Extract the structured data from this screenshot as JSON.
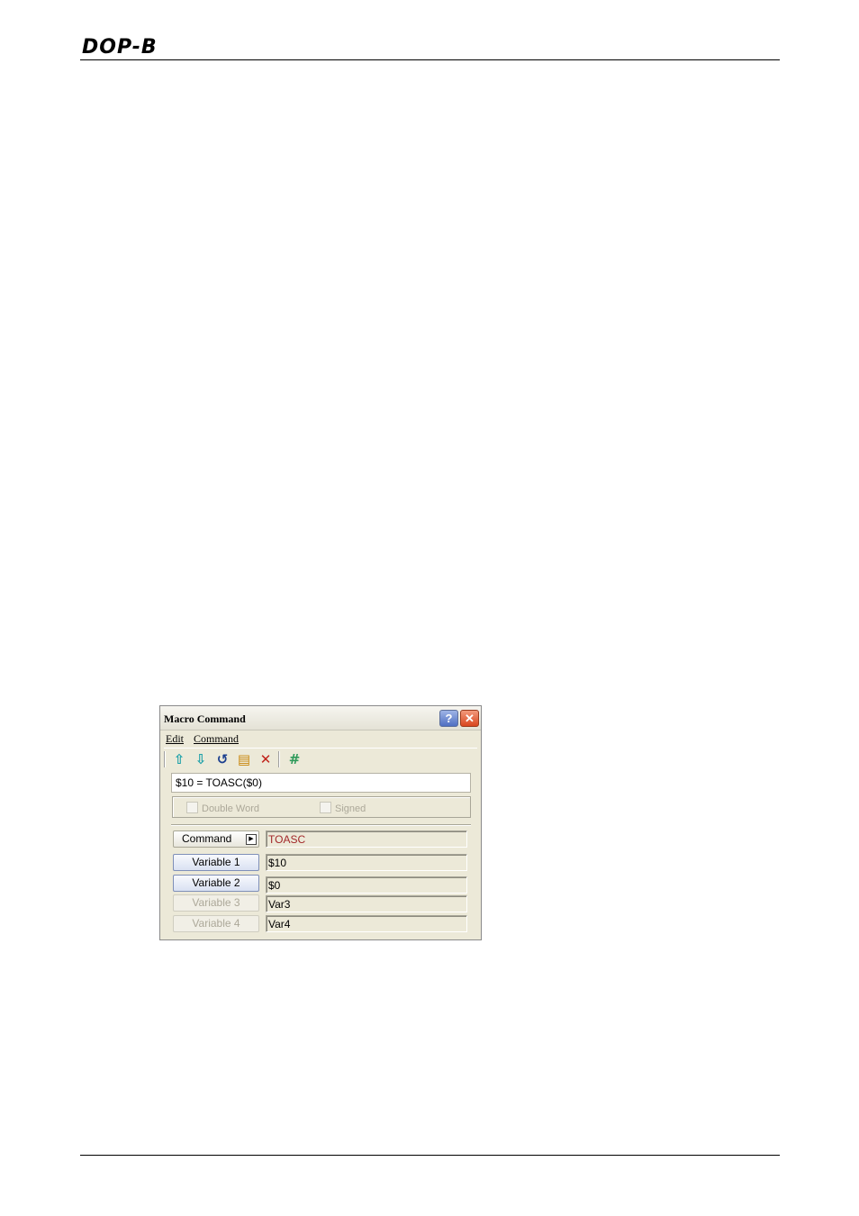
{
  "page": {
    "logo": "DOP-B"
  },
  "dialog": {
    "title": "Macro Command",
    "help_label": "?",
    "close_label": "✕",
    "menu": [
      {
        "label": "Edit"
      },
      {
        "label": "Command"
      }
    ],
    "toolbar": [
      {
        "icon": "arrow-up-icon",
        "glyph": "⇧",
        "color": "#1aa0a8"
      },
      {
        "icon": "arrow-down-icon",
        "glyph": "⇩",
        "color": "#1aa0a8"
      },
      {
        "icon": "undo-icon",
        "glyph": "↺",
        "color": "#1b3f8f"
      },
      {
        "icon": "document-icon",
        "glyph": "▤",
        "color": "#c8860b"
      },
      {
        "icon": "delete-icon",
        "glyph": "✕",
        "color": "#c0221a"
      },
      {
        "icon": "hash-icon",
        "glyph": "#",
        "color": "#2e9a5a"
      }
    ],
    "command_line": "$10 = TOASC($0)",
    "options": {
      "double_word": "Double Word",
      "signed": "Signed"
    },
    "command_button": "Command",
    "command_value": "TOASC",
    "variables": [
      {
        "label": "Variable 1",
        "value": "$10",
        "enabled": true
      },
      {
        "label": "Variable 2",
        "value": "$0",
        "enabled": true
      },
      {
        "label": "Variable 3",
        "value": "Var3",
        "enabled": false
      },
      {
        "label": "Variable 4",
        "value": "Var4",
        "enabled": false
      }
    ]
  }
}
